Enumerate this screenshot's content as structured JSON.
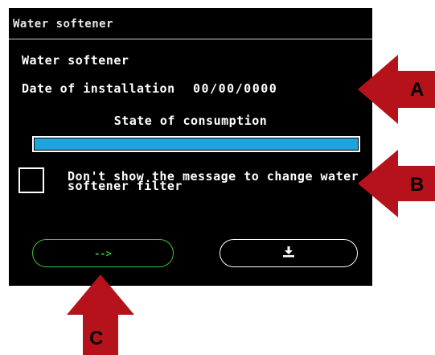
{
  "window": {
    "title": "Water softener"
  },
  "main": {
    "heading": "Water softener",
    "installation_label": "Date of installation",
    "installation_date": "00/00/0000",
    "consumption_label": "State of consumption",
    "consumption_progress_percent": 100,
    "checkbox_checked": false,
    "checkbox_label": "Don't show the message to change water softener filter"
  },
  "buttons": {
    "next_label": "-->",
    "download_icon": "download-icon"
  },
  "annotations": {
    "marker_a": "A",
    "marker_b": "B",
    "marker_c": "C",
    "marker_color": "#b5121b"
  },
  "colors": {
    "screen_bg": "#000000",
    "progress_fill": "#1ea3dc",
    "next_accent": "#3ec23e"
  }
}
